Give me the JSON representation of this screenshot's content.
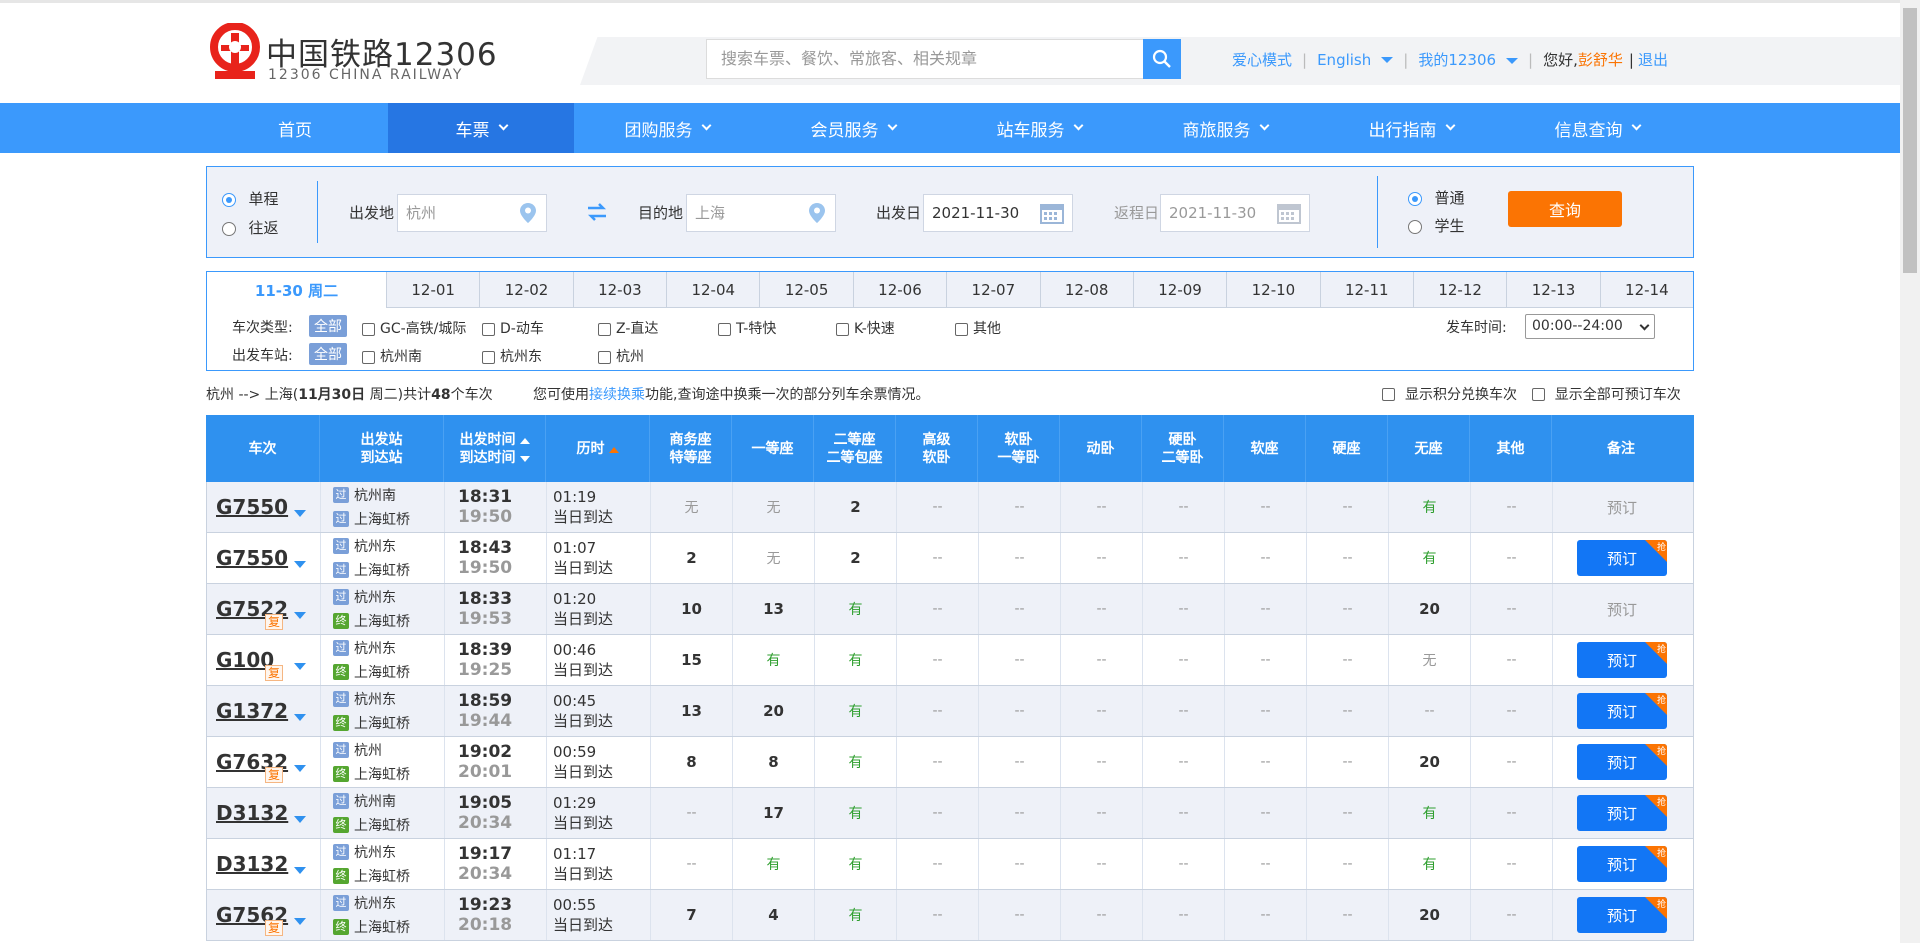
{
  "header": {
    "logo_cn": "中国铁路12306",
    "logo_en": "12306 CHINA RAILWAY",
    "search_placeholder": "搜索车票、餐饮、常旅客、相关规章",
    "links": {
      "care_mode": "爱心模式",
      "english": "English",
      "my12306": "我的12306",
      "greeting": "您好,",
      "username": "彭舒华",
      "logout": "退出",
      "sep": "|"
    }
  },
  "nav": {
    "items": [
      {
        "label": "首页",
        "has_menu": false
      },
      {
        "label": "车票",
        "has_menu": true
      },
      {
        "label": "团购服务",
        "has_menu": true
      },
      {
        "label": "会员服务",
        "has_menu": true
      },
      {
        "label": "站车服务",
        "has_menu": true
      },
      {
        "label": "商旅服务",
        "has_menu": true
      },
      {
        "label": "出行指南",
        "has_menu": true
      },
      {
        "label": "信息查询",
        "has_menu": true
      }
    ]
  },
  "query": {
    "one_way": "单程",
    "round_trip": "往返",
    "from_label": "出发地",
    "from_value": "杭州",
    "to_label": "目的地",
    "to_value": "上海",
    "depart_label": "出发日",
    "depart_value": "2021-11-30",
    "return_label": "返程日",
    "return_value": "2021-11-30",
    "normal": "普通",
    "student": "学生",
    "submit": "查询"
  },
  "dates": {
    "selected": "11-30 周二",
    "others": [
      "12-01",
      "12-02",
      "12-03",
      "12-04",
      "12-05",
      "12-06",
      "12-07",
      "12-08",
      "12-09",
      "12-10",
      "12-11",
      "12-12",
      "12-13",
      "12-14"
    ]
  },
  "filters": {
    "type_label": "车次类型:",
    "station_label": "出发车站:",
    "all": "全部",
    "types": [
      "GC-高铁/城际",
      "D-动车",
      "Z-直达",
      "T-特快",
      "K-快速",
      "其他"
    ],
    "stations": [
      "杭州南",
      "杭州东",
      "杭州"
    ],
    "time_label": "发车时间:",
    "time_value": "00:00--24:00"
  },
  "summary": {
    "route": "杭州 -->  上海(",
    "date_bold": "11月30日",
    "weekday": "  周二)共计",
    "count": "48",
    "count_suffix": "个车次",
    "tip_prefix": "您可使用",
    "tip_link": "接续换乘",
    "tip_suffix": "功能,查询途中换乘一次的部分列车余票情况。",
    "opt1": "显示积分兑换车次",
    "opt2": "显示全部可预订车次"
  },
  "table": {
    "headers": {
      "train": "车次",
      "station_1": "出发站",
      "station_2": "到达站",
      "time_1": "出发时间",
      "time_2": "到达时间",
      "duration": "历时",
      "biz_1": "商务座",
      "biz_2": "特等座",
      "first": "一等座",
      "second_1": "二等座",
      "second_2": "二等包座",
      "hs_1": "高级",
      "hs_2": "软卧",
      "sw_1": "软卧",
      "sw_2": "一等卧",
      "dw": "动卧",
      "yw_1": "硬卧",
      "yw_2": "二等卧",
      "rz": "软座",
      "yz": "硬座",
      "wz": "无座",
      "other": "其他",
      "remark": "备注"
    },
    "rows": [
      {
        "no": "G7550",
        "fu": "",
        "from": "杭州南",
        "from_tag": "过",
        "to": "上海虹桥",
        "to_tag": "过",
        "dep": "18:31",
        "arr": "19:50",
        "dur": "01:19",
        "arrive": "当日到达",
        "seats": [
          "无",
          "无",
          "2",
          "--",
          "--",
          "--",
          "--",
          "--",
          "--",
          "有",
          "--"
        ],
        "book": "预订",
        "bookable": false
      },
      {
        "no": "G7550",
        "fu": "",
        "from": "杭州东",
        "from_tag": "过",
        "to": "上海虹桥",
        "to_tag": "过",
        "dep": "18:43",
        "arr": "19:50",
        "dur": "01:07",
        "arrive": "当日到达",
        "seats": [
          "2",
          "无",
          "2",
          "--",
          "--",
          "--",
          "--",
          "--",
          "--",
          "有",
          "--"
        ],
        "book": "预订",
        "bookable": true
      },
      {
        "no": "G7522",
        "fu": "复",
        "from": "杭州东",
        "from_tag": "过",
        "to": "上海虹桥",
        "to_tag": "终",
        "dep": "18:33",
        "arr": "19:53",
        "dur": "01:20",
        "arrive": "当日到达",
        "seats": [
          "10",
          "13",
          "有",
          "--",
          "--",
          "--",
          "--",
          "--",
          "--",
          "20",
          "--"
        ],
        "book": "预订",
        "bookable": false
      },
      {
        "no": "G100",
        "fu": "复",
        "from": "杭州东",
        "from_tag": "过",
        "to": "上海虹桥",
        "to_tag": "终",
        "dep": "18:39",
        "arr": "19:25",
        "dur": "00:46",
        "arrive": "当日到达",
        "seats": [
          "15",
          "有",
          "有",
          "--",
          "--",
          "--",
          "--",
          "--",
          "--",
          "无",
          "--"
        ],
        "book": "预订",
        "bookable": true
      },
      {
        "no": "G1372",
        "fu": "",
        "from": "杭州东",
        "from_tag": "过",
        "to": "上海虹桥",
        "to_tag": "终",
        "dep": "18:59",
        "arr": "19:44",
        "dur": "00:45",
        "arrive": "当日到达",
        "seats": [
          "13",
          "20",
          "有",
          "--",
          "--",
          "--",
          "--",
          "--",
          "--",
          "--",
          "--"
        ],
        "book": "预订",
        "bookable": true
      },
      {
        "no": "G7632",
        "fu": "复",
        "from": "杭州",
        "from_tag": "过",
        "to": "上海虹桥",
        "to_tag": "终",
        "dep": "19:02",
        "arr": "20:01",
        "dur": "00:59",
        "arrive": "当日到达",
        "seats": [
          "8",
          "8",
          "有",
          "--",
          "--",
          "--",
          "--",
          "--",
          "--",
          "20",
          "--"
        ],
        "book": "预订",
        "bookable": true
      },
      {
        "no": "D3132",
        "fu": "",
        "from": "杭州南",
        "from_tag": "过",
        "to": "上海虹桥",
        "to_tag": "终",
        "dep": "19:05",
        "arr": "20:34",
        "dur": "01:29",
        "arrive": "当日到达",
        "seats": [
          "--",
          "17",
          "有",
          "--",
          "--",
          "--",
          "--",
          "--",
          "--",
          "有",
          "--"
        ],
        "book": "预订",
        "bookable": true
      },
      {
        "no": "D3132",
        "fu": "",
        "from": "杭州东",
        "from_tag": "过",
        "to": "上海虹桥",
        "to_tag": "终",
        "dep": "19:17",
        "arr": "20:34",
        "dur": "01:17",
        "arrive": "当日到达",
        "seats": [
          "--",
          "有",
          "有",
          "--",
          "--",
          "--",
          "--",
          "--",
          "--",
          "有",
          "--"
        ],
        "book": "预订",
        "bookable": true
      },
      {
        "no": "G7562",
        "fu": "复",
        "from": "杭州东",
        "from_tag": "过",
        "to": "上海虹桥",
        "to_tag": "终",
        "dep": "19:23",
        "arr": "20:18",
        "dur": "00:55",
        "arrive": "当日到达",
        "seats": [
          "7",
          "4",
          "有",
          "--",
          "--",
          "--",
          "--",
          "--",
          "--",
          "20",
          "--"
        ],
        "book": "预订",
        "bookable": true
      }
    ],
    "corner_text": "抢"
  },
  "colors": {
    "primary": "#3b99fc",
    "nav_active": "#2676e3",
    "orange": "#fb7403",
    "green": "#2f9f2f",
    "panel_bg": "#eef1f8"
  }
}
